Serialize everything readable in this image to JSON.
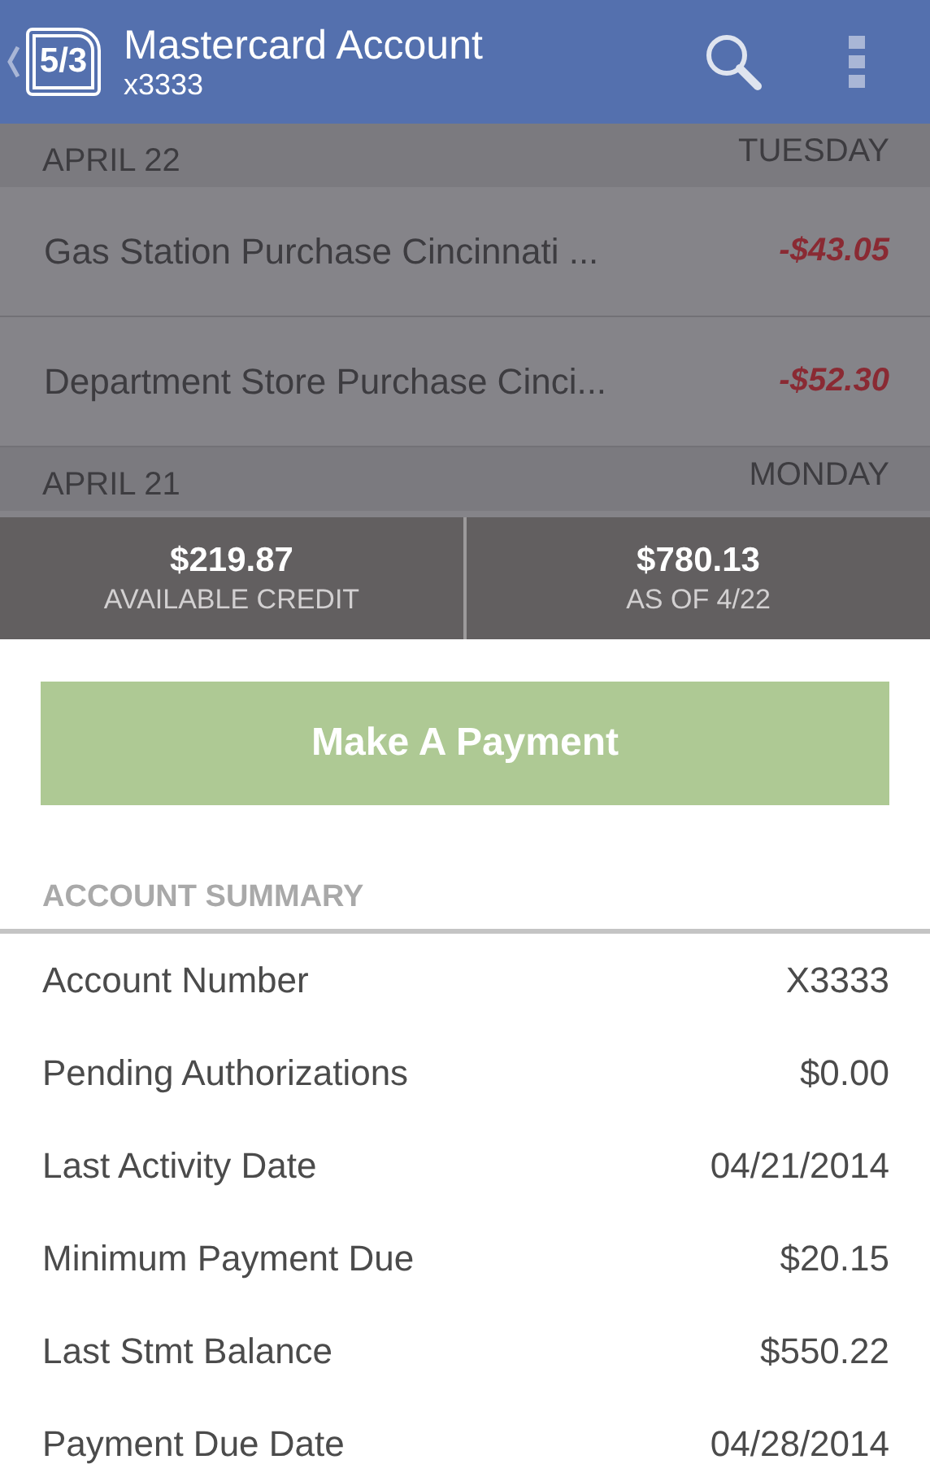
{
  "header": {
    "logo": "5/3",
    "title": "Mastercard Account",
    "subtitle": "x3333"
  },
  "activity": [
    {
      "kind": "day",
      "date": "APRIL 22",
      "weekday": "TUESDAY"
    },
    {
      "kind": "transaction",
      "description": "Gas Station Purchase Cincinnati ...",
      "amount": "-$43.05"
    },
    {
      "kind": "transaction",
      "description": "Department Store Purchase Cinci...",
      "amount": "-$52.30"
    },
    {
      "kind": "day",
      "date": "APRIL 21",
      "weekday": "MONDAY"
    }
  ],
  "balances": [
    {
      "amount": "$219.87",
      "label": "AVAILABLE CREDIT"
    },
    {
      "amount": "$780.13",
      "label": "AS OF 4/22"
    }
  ],
  "payment_button": "Make A Payment",
  "summary": {
    "heading": "ACCOUNT SUMMARY",
    "rows": [
      {
        "label": "Account Number",
        "value": "X3333"
      },
      {
        "label": "Pending Authorizations",
        "value": "$0.00"
      },
      {
        "label": "Last Activity Date",
        "value": "04/21/2014"
      },
      {
        "label": "Minimum Payment Due",
        "value": "$20.15"
      },
      {
        "label": "Last Stmt Balance",
        "value": "$550.22"
      },
      {
        "label": "Payment Due Date",
        "value": "04/28/2014"
      }
    ]
  }
}
